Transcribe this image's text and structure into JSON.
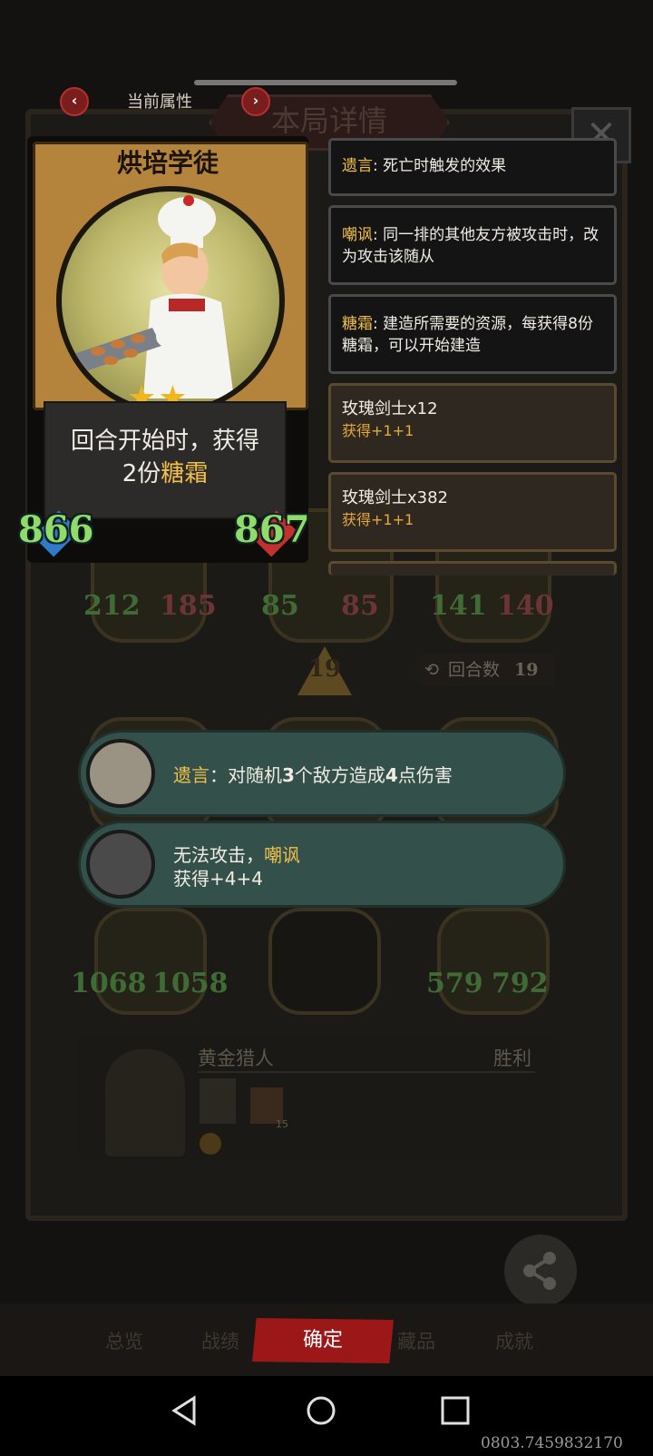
{
  "header": {
    "current_attr_label": "当前属性",
    "prev_icon": "chevron-left-icon",
    "next_icon": "chevron-right-icon",
    "background_title": "本局详情",
    "close_glyph": "✕"
  },
  "card": {
    "name": "烘培学徒",
    "stars": "★★",
    "desc_line1": "回合开始时，获得",
    "desc_line2_prefix": "2份",
    "desc_line2_keyword": "糖霜",
    "attack": "866",
    "health": "867"
  },
  "tips": [
    {
      "keyword": "遗言",
      "text": ": 死亡时触发的效果"
    },
    {
      "keyword": "嘲讽",
      "text": ": 同一排的其他友方被攻击时，改为攻击该随从"
    },
    {
      "keyword": "糖霜",
      "text": ": 建造所需要的资源，每获得8份糖霜，可以开始建造"
    }
  ],
  "gains": [
    {
      "name": "玫瑰剑士x12",
      "gain": "获得+1+1"
    },
    {
      "name": "玫瑰剑士x382",
      "gain": "获得+1+1"
    }
  ],
  "board": {
    "row1": [
      [
        "212",
        "185"
      ],
      [
        "85",
        "85"
      ],
      [
        "141",
        "140"
      ]
    ],
    "row3": [
      [
        "1068",
        "1058"
      ],
      [
        "579",
        "792"
      ]
    ],
    "round_badge": "19",
    "round_label": "回合数",
    "round_value": "19"
  },
  "effects": [
    {
      "keyword": "遗言",
      "text_a": "：对随机",
      "num1": "3",
      "text_b": "个敌方造成",
      "num2": "4",
      "text_c": "点伤害"
    },
    {
      "text_a": "无法攻击，",
      "keyword": "嘲讽",
      "gain": "获得+4+4"
    }
  ],
  "opponent": {
    "name": "黄金猎人",
    "result": "胜利",
    "item_count": "15"
  },
  "bottom": {
    "tabs": [
      "总览",
      "战绩",
      "藏品",
      "成就"
    ],
    "confirm": "确定",
    "share": "分享"
  },
  "timestamp": "0803.7459832170",
  "colors": {
    "keyword": "#f2c04a",
    "attack": "#8fdc6a",
    "confirm": "#9c1818",
    "pill": "#33514a"
  }
}
